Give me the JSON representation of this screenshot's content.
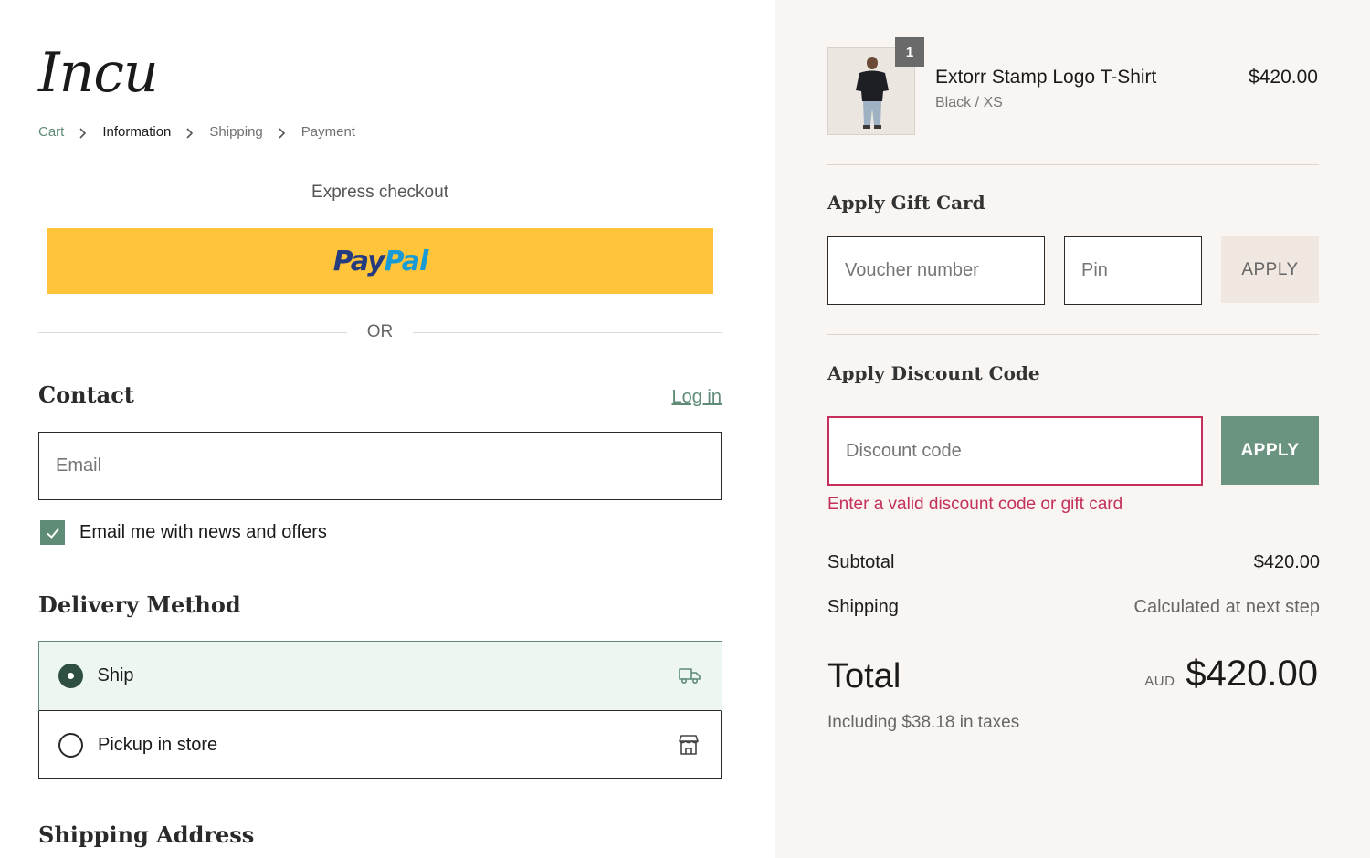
{
  "brand": {
    "logo_text": "Incu"
  },
  "breadcrumb": {
    "items": [
      {
        "label": "Cart",
        "state": "link"
      },
      {
        "label": "Information",
        "state": "current"
      },
      {
        "label": "Shipping",
        "state": "upcoming"
      },
      {
        "label": "Payment",
        "state": "upcoming"
      }
    ]
  },
  "express": {
    "title": "Express checkout",
    "paypal_pay": "Pay",
    "paypal_pal": "Pal",
    "or_label": "OR"
  },
  "contact": {
    "title": "Contact",
    "login_label": "Log in",
    "email_placeholder": "Email",
    "newsletter_label": "Email me with news and offers",
    "newsletter_checked": true
  },
  "delivery": {
    "title": "Delivery Method",
    "options": [
      {
        "label": "Ship",
        "selected": true,
        "icon": "truck-icon"
      },
      {
        "label": "Pickup in store",
        "selected": false,
        "icon": "store-icon"
      }
    ]
  },
  "shipping_address": {
    "title": "Shipping Address"
  },
  "order": {
    "product": {
      "name": "Extorr Stamp Logo T-Shirt",
      "variant": "Black / XS",
      "price": "$420.00",
      "quantity": "1"
    },
    "gift_card": {
      "title": "Apply Gift Card",
      "voucher_placeholder": "Voucher number",
      "pin_placeholder": "Pin",
      "apply_label": "APPLY"
    },
    "discount": {
      "title": "Apply Discount Code",
      "placeholder": "Discount code",
      "apply_label": "APPLY",
      "error": "Enter a valid discount code or gift card"
    },
    "summary": {
      "subtotal_label": "Subtotal",
      "subtotal_value": "$420.00",
      "shipping_label": "Shipping",
      "shipping_value": "Calculated at next step",
      "total_label": "Total",
      "currency": "AUD",
      "total_value": "$420.00",
      "taxes_note": "Including $38.18 in taxes"
    }
  },
  "colors": {
    "accent_green": "#5e8c77",
    "paypal_yellow": "#ffc439",
    "error_red": "#c4305b",
    "summary_bg": "#f8f5f2"
  }
}
